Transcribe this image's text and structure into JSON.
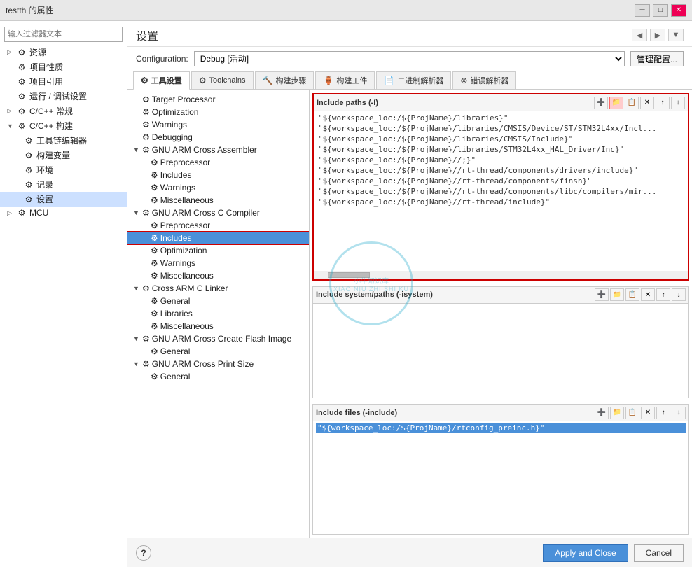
{
  "window": {
    "title": "testth 的属性",
    "minimize_label": "─",
    "maximize_label": "□",
    "close_label": "✕"
  },
  "sidebar": {
    "filter_placeholder": "输入过滤器文本",
    "items": [
      {
        "label": "资源",
        "level": 0,
        "arrow": "▷"
      },
      {
        "label": "项目性质",
        "level": 0,
        "arrow": ""
      },
      {
        "label": "项目引用",
        "level": 0,
        "arrow": ""
      },
      {
        "label": "运行 / 调试设置",
        "level": 0,
        "arrow": ""
      },
      {
        "label": "C/C++ 常规",
        "level": 0,
        "arrow": "▷"
      },
      {
        "label": "C/C++ 构建",
        "level": 0,
        "arrow": "▼"
      },
      {
        "label": "工具链编辑器",
        "level": 1,
        "arrow": ""
      },
      {
        "label": "构建变量",
        "level": 1,
        "arrow": ""
      },
      {
        "label": "环境",
        "level": 1,
        "arrow": ""
      },
      {
        "label": "记录",
        "level": 1,
        "arrow": ""
      },
      {
        "label": "设置",
        "level": 1,
        "arrow": "",
        "selected": true
      },
      {
        "label": "MCU",
        "level": 0,
        "arrow": "▷"
      }
    ]
  },
  "content": {
    "title": "设置",
    "nav": {
      "back": "◀",
      "forward": "▶",
      "dropdown": "▼"
    },
    "config": {
      "label": "Configuration:",
      "value": "Debug [活动]",
      "manage_btn": "管理配置..."
    },
    "tabs": [
      {
        "label": "工具设置",
        "icon": "⚙",
        "active": true
      },
      {
        "label": "Toolchains",
        "icon": "⚙"
      },
      {
        "label": "构建步骤",
        "icon": "🔨"
      },
      {
        "label": "构建工件",
        "icon": "🏺"
      },
      {
        "label": "二进制解析器",
        "icon": "📄"
      },
      {
        "label": "错误解析器",
        "icon": "⊗"
      }
    ]
  },
  "tree": {
    "items": [
      {
        "label": "Target Processor",
        "level": 0,
        "icon": "⚙"
      },
      {
        "label": "Optimization",
        "level": 0,
        "icon": "⚙"
      },
      {
        "label": "Warnings",
        "level": 0,
        "icon": "⚙"
      },
      {
        "label": "Debugging",
        "level": 0,
        "icon": "⚙"
      },
      {
        "label": "GNU ARM Cross Assembler",
        "level": 0,
        "icon": "⚙",
        "arrow": "▼"
      },
      {
        "label": "Preprocessor",
        "level": 1,
        "icon": "⚙"
      },
      {
        "label": "Includes",
        "level": 1,
        "icon": "⚙"
      },
      {
        "label": "Warnings",
        "level": 1,
        "icon": "⚙"
      },
      {
        "label": "Miscellaneous",
        "level": 1,
        "icon": "⚙"
      },
      {
        "label": "GNU ARM Cross C Compiler",
        "level": 0,
        "icon": "⚙",
        "arrow": "▼"
      },
      {
        "label": "Preprocessor",
        "level": 1,
        "icon": "⚙"
      },
      {
        "label": "Includes",
        "level": 1,
        "icon": "⚙",
        "selected": true
      },
      {
        "label": "Optimization",
        "level": 1,
        "icon": "⚙"
      },
      {
        "label": "Warnings",
        "level": 1,
        "icon": "⚙"
      },
      {
        "label": "Miscellaneous",
        "level": 1,
        "icon": "⚙"
      },
      {
        "label": "Cross ARM C Linker",
        "level": 0,
        "icon": "⚙",
        "arrow": "▼"
      },
      {
        "label": "General",
        "level": 1,
        "icon": "⚙"
      },
      {
        "label": "Libraries",
        "level": 1,
        "icon": "⚙"
      },
      {
        "label": "Miscellaneous",
        "level": 1,
        "icon": "⚙"
      },
      {
        "label": "GNU ARM Cross Create Flash Image",
        "level": 0,
        "icon": "⚙",
        "arrow": "▼"
      },
      {
        "label": "General",
        "level": 1,
        "icon": "⚙"
      },
      {
        "label": "GNU ARM Cross Print Size",
        "level": 0,
        "icon": "⚙",
        "arrow": "▼"
      },
      {
        "label": "General",
        "level": 1,
        "icon": "⚙"
      }
    ]
  },
  "panels": {
    "include_paths": {
      "title": "Include paths (-I)",
      "highlighted": true,
      "paths": [
        "\"${workspace_loc:/${ProjName}/libraries}\"",
        "\"${workspace_loc:/${ProjName}/libraries/CMSIS/Device/ST/STM32L4xx/Incl...",
        "\"${workspace_loc:/${ProjName}/libraries/CMSIS/Include}\"",
        "\"${workspace_loc:/${ProjName}/libraries/STM32L4xx_HAL_Driver/Inc}\"",
        "\"${workspace_loc:/${ProjName}//;}\"",
        "\"${workspace_loc:/${ProjName}//rt-thread/components/drivers/include}\"",
        "\"${workspace_loc:/${ProjName}//rt-thread/components/finsh}\"",
        "\"${workspace_loc:/${ProjName}//rt-thread/components/libc/compilers/mir...",
        "\"${workspace_loc:/${ProjName}//rt-thread/include}\""
      ]
    },
    "include_system_paths": {
      "title": "Include system/paths (-isystem)",
      "paths": []
    },
    "include_files": {
      "title": "Include files (-include)",
      "paths": [
        "\"${workspace_loc:/${ProjName}/rtconfig_preinc.h}\""
      ]
    }
  },
  "toolbar_icons": {
    "add": "➕",
    "add_workspace": "📁",
    "copy": "📋",
    "delete": "✕",
    "up": "↑",
    "down": "↓"
  },
  "bottom": {
    "help": "?",
    "apply_close": "Apply and Close",
    "cancel": "Cancel"
  },
  "watermark": {
    "line1": "小牛知识库",
    "line2": "XIAO NIU ZHI SHI KU"
  }
}
